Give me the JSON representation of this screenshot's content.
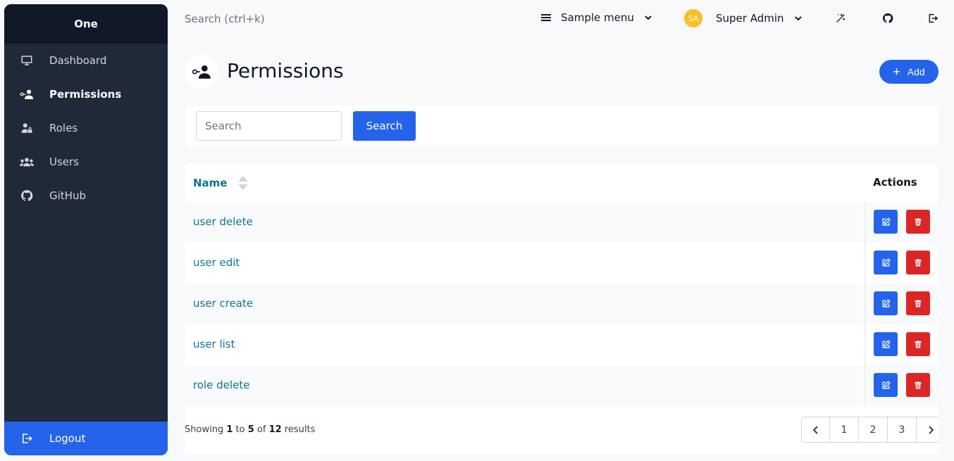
{
  "sidebar": {
    "brand": "One",
    "items": [
      {
        "label": "Dashboard",
        "icon": "monitor-icon"
      },
      {
        "label": "Permissions",
        "icon": "user-key-icon",
        "active": true
      },
      {
        "label": "Roles",
        "icon": "user-lock-icon"
      },
      {
        "label": "Users",
        "icon": "users-icon"
      },
      {
        "label": "GitHub",
        "icon": "github-icon"
      }
    ],
    "logout": "Logout"
  },
  "topbar": {
    "search_placeholder": "Search (ctrl+k)",
    "menu_label": "Sample menu",
    "user_initials": "SA",
    "user_name": "Super Admin",
    "avatar_color": "#fbbf24"
  },
  "page": {
    "title": "Permissions",
    "add_label": "Add"
  },
  "search": {
    "placeholder": "Search",
    "button_label": "Search"
  },
  "table": {
    "columns": {
      "name": "Name",
      "actions": "Actions"
    },
    "rows": [
      {
        "name": "user delete"
      },
      {
        "name": "user edit"
      },
      {
        "name": "user create"
      },
      {
        "name": "user list"
      },
      {
        "name": "role delete"
      }
    ]
  },
  "pagination": {
    "showing_prefix": "Showing",
    "from": "1",
    "to_word": "to",
    "to": "5",
    "of_word": "of",
    "total": "12",
    "results_word": "results",
    "pages": [
      "1",
      "2",
      "3"
    ]
  },
  "colors": {
    "primary": "#2563eb",
    "danger": "#dc2626",
    "link": "#0e7490",
    "sidebar": "#1f2937"
  }
}
